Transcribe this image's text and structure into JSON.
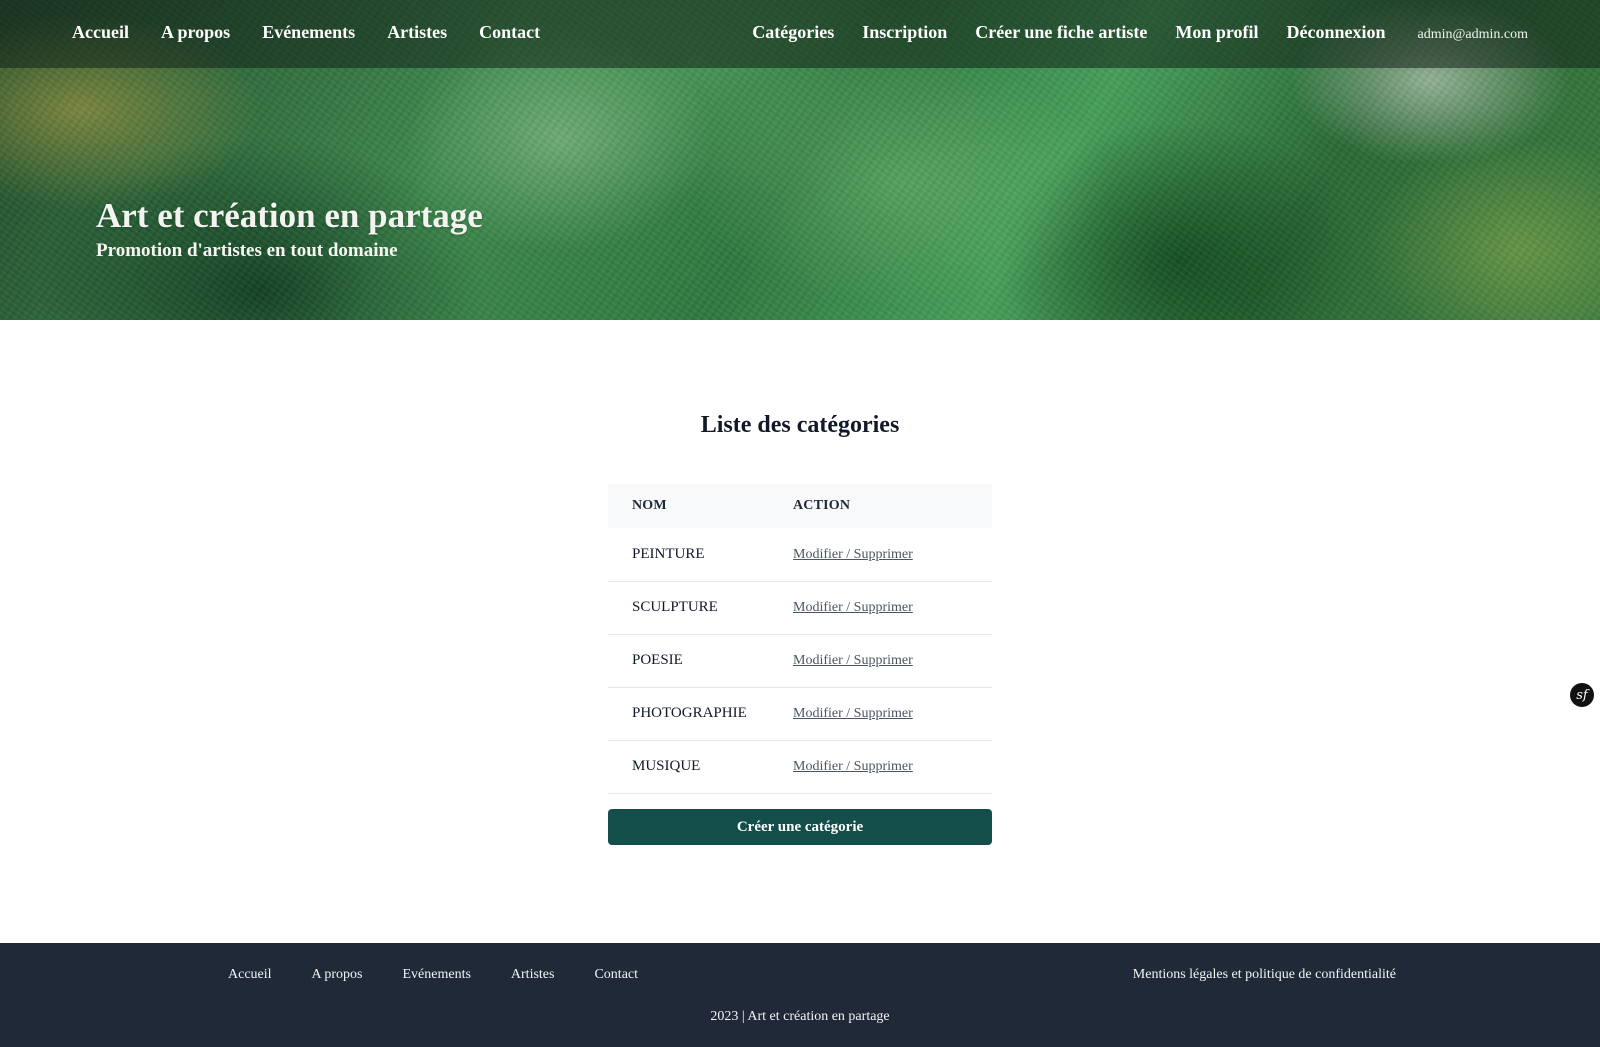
{
  "nav": {
    "left": [
      "Accueil",
      "A propos",
      "Evénements",
      "Artistes",
      "Contact"
    ],
    "right": [
      "Catégories",
      "Inscription",
      "Créer une fiche artiste",
      "Mon profil",
      "Déconnexion"
    ],
    "user_email": "admin@admin.com"
  },
  "hero": {
    "title": "Art et création en partage",
    "subtitle": "Promotion d'artistes en tout domaine"
  },
  "main": {
    "title": "Liste des catégories",
    "columns": [
      "NOM",
      "ACTION"
    ],
    "rows": [
      {
        "name": "PEINTURE",
        "action": "Modifier / Supprimer"
      },
      {
        "name": "SCULPTURE",
        "action": "Modifier / Supprimer"
      },
      {
        "name": "POESIE",
        "action": "Modifier / Supprimer"
      },
      {
        "name": "PHOTOGRAPHIE",
        "action": "Modifier / Supprimer"
      },
      {
        "name": "MUSIQUE",
        "action": "Modifier / Supprimer"
      }
    ],
    "create_button": "Créer une catégorie"
  },
  "toolbar": {
    "icon": "symfony-icon",
    "glyph": "sf"
  },
  "footer": {
    "links": [
      "Accueil",
      "A propos",
      "Evénements",
      "Artistes",
      "Contact"
    ],
    "legal": "Mentions légales et politique de confidentialité",
    "copyright": "2023 | Art et création en partage"
  },
  "colors": {
    "primary_button": "#134e4a",
    "footer_bg": "#1f2937",
    "table_header_bg": "#f8f9fa"
  }
}
